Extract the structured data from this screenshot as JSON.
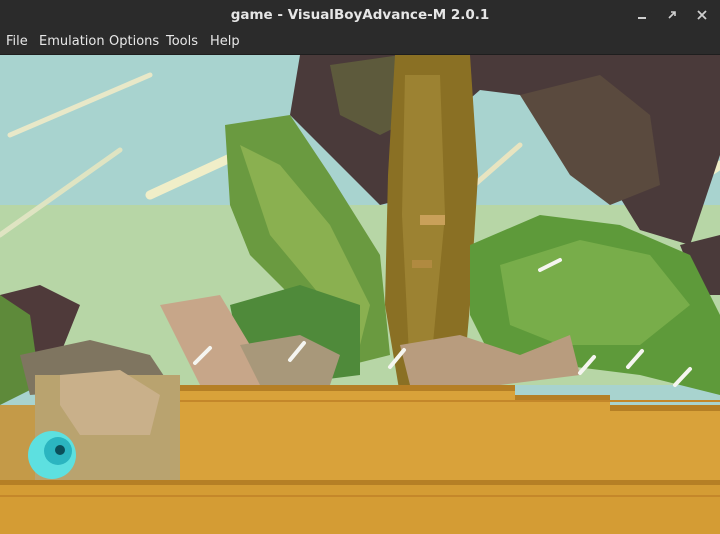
{
  "window": {
    "title": "game - VisualBoyAdvance-M 2.0.1",
    "controls": {
      "minimize": "minimize-icon",
      "maximize": "maximize-icon",
      "close": "close-icon"
    }
  },
  "menu": {
    "file": "File",
    "emulation": "Emulation",
    "options": "Options",
    "tools": "Tools",
    "help": "Help"
  },
  "game": {
    "palette": {
      "sky": "#a8d3cf",
      "tree_trunk": "#8a7024",
      "dark_foliage": "#4a3a3a",
      "leaves": "#6a9a40",
      "ground": "#d9a23a",
      "player": "#5de0e0"
    }
  }
}
